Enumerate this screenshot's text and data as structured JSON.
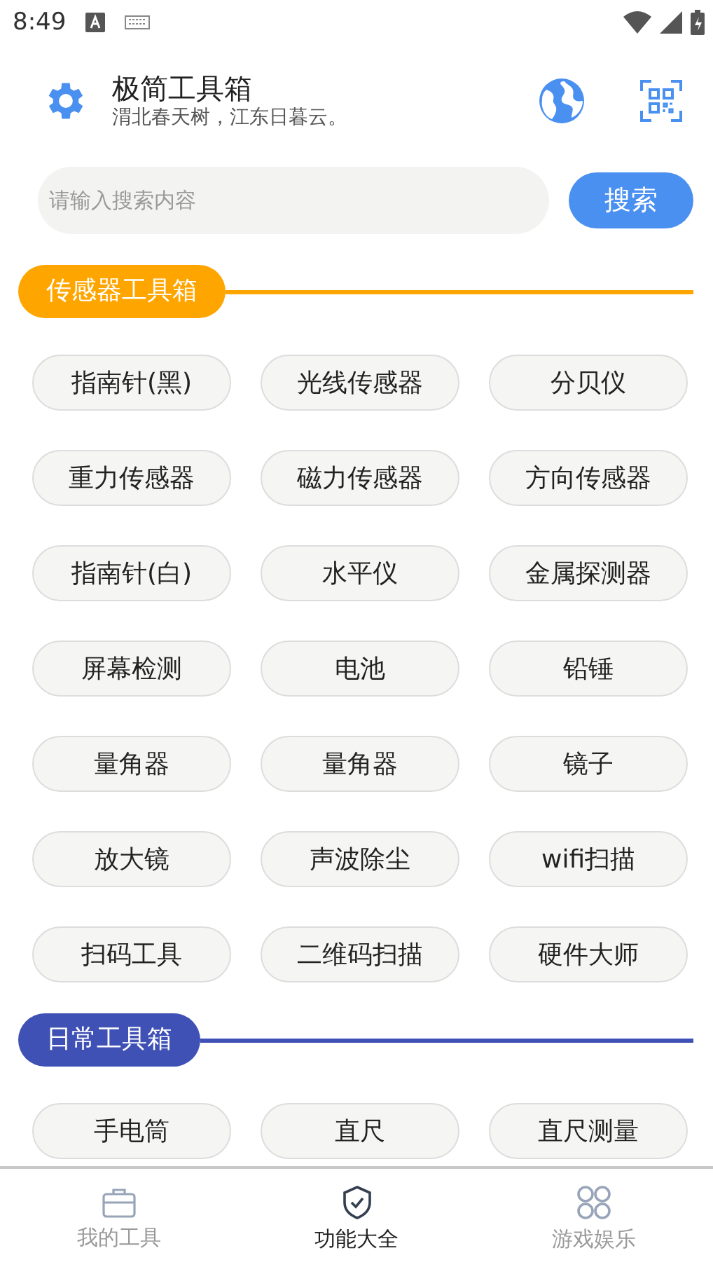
{
  "status_bar": {
    "time": "8:49"
  },
  "header": {
    "title": "极简工具箱",
    "subtitle": "渭北春天树，江东日暮云。"
  },
  "search": {
    "placeholder": "请输入搜索内容",
    "button": "搜索"
  },
  "sections": [
    {
      "title": "传感器工具箱",
      "color": "#ffa500",
      "tools": [
        "指南针(黑)",
        "光线传感器",
        "分贝仪",
        "重力传感器",
        "磁力传感器",
        "方向传感器",
        "指南针(白)",
        "水平仪",
        "金属探测器",
        "屏幕检测",
        "电池",
        "铅锤",
        "量角器",
        "量角器",
        "镜子",
        "放大镜",
        "声波除尘",
        "wifi扫描",
        "扫码工具",
        "二维码扫描",
        "硬件大师"
      ]
    },
    {
      "title": "日常工具箱",
      "color": "#3f51b5",
      "tools": [
        "手电筒",
        "直尺",
        "直尺测量"
      ]
    }
  ],
  "nav": [
    {
      "label": "我的工具",
      "kind": "briefcase",
      "selected": false
    },
    {
      "label": "功能大全",
      "kind": "shield",
      "selected": true
    },
    {
      "label": "游戏娱乐",
      "kind": "grid",
      "selected": false
    }
  ]
}
